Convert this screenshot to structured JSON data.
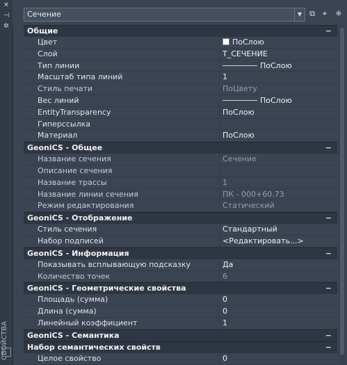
{
  "side": {
    "label": "СВОЙСТВА"
  },
  "header": {
    "selector_value": "Сечение"
  },
  "sections": [
    {
      "title": "Общие",
      "rows": [
        {
          "label": "Цвет",
          "value": "ПоСлою",
          "kind": "color"
        },
        {
          "label": "Слой",
          "value": "Т_СЕЧЕНИЕ"
        },
        {
          "label": "Тип линии",
          "value": "ПоСлою",
          "kind": "line"
        },
        {
          "label": "Масштаб типа линий",
          "value": "1"
        },
        {
          "label": "Стиль печати",
          "value": "ПоЦвету",
          "dim": true
        },
        {
          "label": "Вес линий",
          "value": "ПоСлою",
          "kind": "line"
        },
        {
          "label": "EntityTransparency",
          "value": "ПоСлою"
        },
        {
          "label": "Гиперссылка",
          "value": ""
        },
        {
          "label": "Материал",
          "value": "ПоСлою"
        }
      ]
    },
    {
      "title": "GeoniCS - Общее",
      "rows": [
        {
          "label": "Название сечения",
          "value": "Сечение",
          "dim": true
        },
        {
          "label": "Описание сечения",
          "value": "",
          "dim": true
        },
        {
          "label": "Название трассы",
          "value": "1",
          "dim": true
        },
        {
          "label": "Название линии сечения",
          "value": "ПК - 000+60.73",
          "dim": true
        },
        {
          "label": "Режим редактирования",
          "value": "Статический",
          "dim": true
        }
      ]
    },
    {
      "title": "GeoniCS - Отображение",
      "rows": [
        {
          "label": "Стиль сечения",
          "value": "Стандартный"
        },
        {
          "label": "Набор подписей",
          "value": "<Редактировать...>"
        }
      ]
    },
    {
      "title": "GeoniCS - Информация",
      "rows": [
        {
          "label": "Показывать всплывающую подсказку",
          "value": "Да"
        },
        {
          "label": "Количество точек",
          "value": "6",
          "dim": true
        }
      ]
    },
    {
      "title": "GeoniCS - Геометрические свойства",
      "rows": [
        {
          "label": "Площадь (сумма)",
          "value": "0"
        },
        {
          "label": "Длина (сумма)",
          "value": "0"
        },
        {
          "label": "Линейный коэффициент",
          "value": "1"
        }
      ]
    },
    {
      "title": "GeoniCS - Семантика",
      "rows": []
    },
    {
      "title": "Набор семантических свойств",
      "rows": [
        {
          "label": "Целое свойство",
          "value": "0"
        }
      ]
    }
  ]
}
